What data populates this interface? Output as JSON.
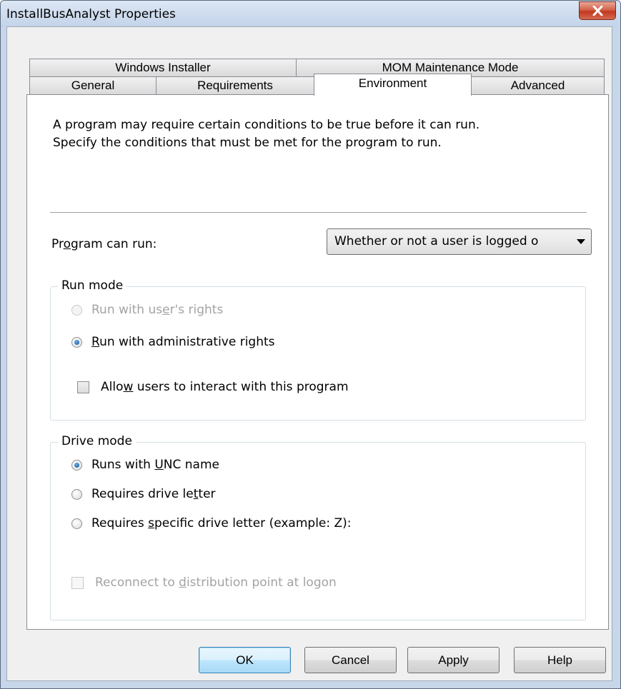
{
  "window": {
    "title": "InstallBusAnalyst Properties"
  },
  "tabs": {
    "row1": [
      {
        "label": "Windows Installer"
      },
      {
        "label": "MOM Maintenance Mode"
      }
    ],
    "row2": [
      {
        "label": "General"
      },
      {
        "label": "Requirements"
      },
      {
        "label": "Environment"
      },
      {
        "label": "Advanced"
      }
    ],
    "active": "Environment"
  },
  "description": {
    "line1": "A program may require certain conditions to be true before it can run.",
    "line2": "Specify the conditions that must be met for the program to run."
  },
  "program_can_run": {
    "label_pre": "Pr",
    "label_key": "o",
    "label_post": "gram can run:",
    "selected": "Whether or not a user is logged o"
  },
  "run_mode": {
    "title": "Run mode",
    "users_rights": {
      "pre": "Run with us",
      "key": "e",
      "post": "r's rights",
      "selected": false,
      "enabled": false
    },
    "admin_rights": {
      "pre": "",
      "key": "R",
      "post": "un with administrative rights",
      "selected": true,
      "enabled": true
    },
    "allow_interact": {
      "pre": "Allo",
      "key": "w",
      "post": " users to interact with this program",
      "checked": false,
      "enabled": true
    }
  },
  "drive_mode": {
    "title": "Drive mode",
    "unc": {
      "pre": "Runs with ",
      "key": "U",
      "post": "NC name",
      "selected": true
    },
    "drive_letter": {
      "pre": "Requires drive le",
      "key": "t",
      "post": "ter",
      "selected": false
    },
    "specific_letter": {
      "pre": "Requires ",
      "key": "s",
      "post": "pecific drive letter (example: Z):",
      "selected": false
    },
    "reconnect": {
      "pre": "Reconnect to ",
      "key": "d",
      "post": "istribution point at logon",
      "checked": false,
      "enabled": false
    }
  },
  "buttons": {
    "ok": "OK",
    "cancel": "Cancel",
    "apply": "Apply",
    "help": "Help"
  },
  "colors": {
    "title_bar": "#c7d6e9",
    "close_button": "#c2381f",
    "radio_dot": "#1e5fa3",
    "default_button_border": "#3c7fb1"
  },
  "icons": {
    "close": "close-x-icon",
    "dropdown": "chevron-down-icon"
  }
}
